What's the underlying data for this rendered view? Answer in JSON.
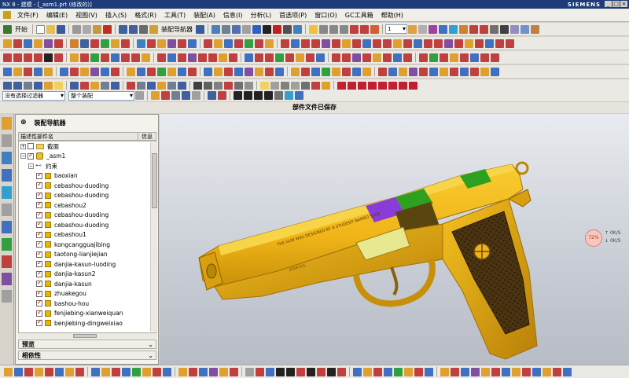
{
  "window": {
    "title": "NX 8 - 建模 - [_asm1.prt (修改的)]",
    "brand": "SIEMENS"
  },
  "menu": [
    "开始",
    "文件(F)",
    "编辑(E)",
    "视图(V)",
    "插入(S)",
    "格式(R)",
    "工具(T)",
    "装配(A)",
    "信息(I)",
    "分析(L)",
    "首选项(P)",
    "窗口(O)",
    "GC工具箱",
    "帮助(H)"
  ],
  "toolbar": {
    "start_label": "开始",
    "assembly_navigator_label": "装配导航器",
    "zoom_value": "1"
  },
  "selection": {
    "filter": "没有选择过滤器",
    "scope": "整个装配"
  },
  "status_message": "部件文件已保存",
  "navigator": {
    "title": "装配导航器",
    "col_name": "描述性部件名",
    "col_info": "信息",
    "rows": [
      {
        "name": "截面",
        "level": 0,
        "kind": "folder"
      },
      {
        "name": "_asm1",
        "level": 0,
        "kind": "asm"
      },
      {
        "name": "约束",
        "level": 1,
        "kind": "constraint"
      },
      {
        "name": "baoxian",
        "level": 2,
        "kind": "part"
      },
      {
        "name": "cebashou-duoding",
        "level": 2,
        "kind": "part"
      },
      {
        "name": "cebashou-duoding",
        "level": 2,
        "kind": "part"
      },
      {
        "name": "cebashou2",
        "level": 2,
        "kind": "part"
      },
      {
        "name": "cebashou-duoding",
        "level": 2,
        "kind": "part"
      },
      {
        "name": "cebashou-duoding",
        "level": 2,
        "kind": "part"
      },
      {
        "name": "cebashou1",
        "level": 2,
        "kind": "part"
      },
      {
        "name": "kongcangguajibing",
        "level": 2,
        "kind": "part"
      },
      {
        "name": "taotong-lianjiejian",
        "level": 2,
        "kind": "part"
      },
      {
        "name": "danjia-kasun-luoding",
        "level": 2,
        "kind": "part"
      },
      {
        "name": "danjia-kasun2",
        "level": 2,
        "kind": "part"
      },
      {
        "name": "danjia-kasun",
        "level": 2,
        "kind": "part"
      },
      {
        "name": "zhuakegou",
        "level": 2,
        "kind": "part"
      },
      {
        "name": "bashou-hou",
        "level": 2,
        "kind": "part"
      },
      {
        "name": "fenjiebing-xianweiquan",
        "level": 2,
        "kind": "part"
      },
      {
        "name": "benjiebing-dingweixiao",
        "level": 2,
        "kind": "part"
      }
    ],
    "preview_label": "预览",
    "dependency_label": "相依性"
  },
  "viewport": {
    "engraving": "THE GUN WAS DESIGNED BY A STUDENT NAMED SUGE",
    "serial": "2018-011",
    "speed_widget": {
      "percent": "72%",
      "up": "0K/S",
      "down": "0K/S"
    }
  },
  "colors": {
    "gun_body": "#f0b418",
    "gun_dark": "#c08808",
    "grip_panel": "#3c2a10",
    "accent_purple": "#8a3cd8",
    "accent_green": "#2ea020",
    "titlebar": "#1e3c78"
  }
}
